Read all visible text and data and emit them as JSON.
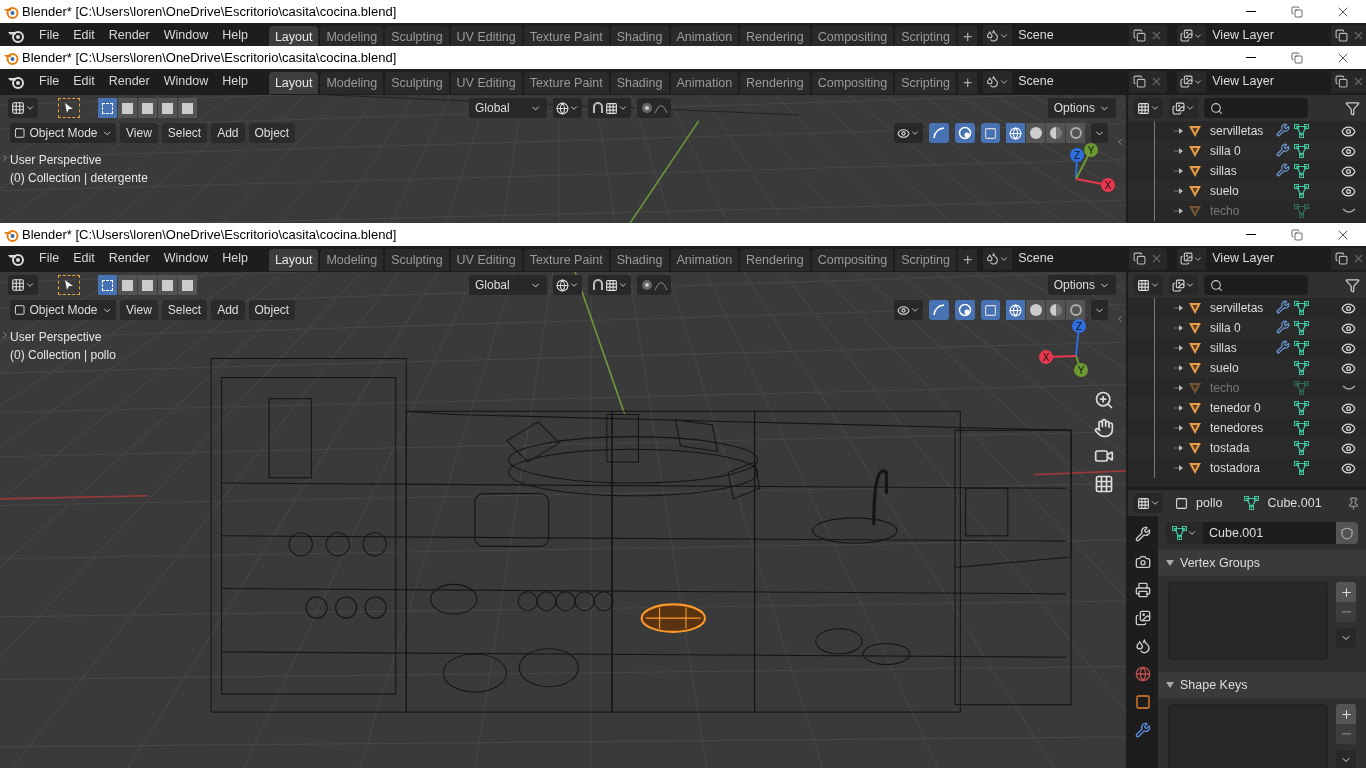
{
  "windows": [
    {
      "title": "Blender* [C:\\Users\\loren\\OneDrive\\Escritorio\\casita\\cocina.blend]",
      "menu": [
        "File",
        "Edit",
        "Render",
        "Window",
        "Help"
      ],
      "workspaces": [
        {
          "label": "Layout",
          "selected": true
        },
        {
          "label": "Modeling",
          "selected": false
        },
        {
          "label": "Sculpting",
          "selected": false
        },
        {
          "label": "UV Editing",
          "selected": false
        },
        {
          "label": "Texture Paint",
          "selected": false
        },
        {
          "label": "Shading",
          "selected": false
        },
        {
          "label": "Animation",
          "selected": false
        },
        {
          "label": "Rendering",
          "selected": false
        },
        {
          "label": "Compositing",
          "selected": false
        },
        {
          "label": "Scripting",
          "selected": false
        }
      ],
      "add_tab": "+",
      "scene": "Scene",
      "view_layer": "View Layer"
    },
    {
      "title": "Blender* [C:\\Users\\loren\\OneDrive\\Escritorio\\casita\\cocina.blend]",
      "menu": [
        "File",
        "Edit",
        "Render",
        "Window",
        "Help"
      ],
      "workspaces": [
        {
          "label": "Layout",
          "selected": true
        },
        {
          "label": "Modeling",
          "selected": false
        },
        {
          "label": "Sculpting",
          "selected": false
        },
        {
          "label": "UV Editing",
          "selected": false
        },
        {
          "label": "Texture Paint",
          "selected": false
        },
        {
          "label": "Shading",
          "selected": false
        },
        {
          "label": "Animation",
          "selected": false
        },
        {
          "label": "Rendering",
          "selected": false
        },
        {
          "label": "Compositing",
          "selected": false
        },
        {
          "label": "Scripting",
          "selected": false
        }
      ],
      "add_tab": "+",
      "scene": "Scene",
      "view_layer": "View Layer",
      "viewport": {
        "transform": "Global",
        "options": "Options",
        "mode": "Object Mode",
        "menus": [
          "View",
          "Select",
          "Add",
          "Object"
        ],
        "perspective": "User Perspective",
        "collection": "(0) Collection | detergente",
        "gizmo": [
          "Z",
          "Y",
          "X"
        ],
        "select_modes": [
          {
            "selected": true
          },
          {
            "selected": false
          },
          {
            "selected": false
          },
          {
            "selected": false
          },
          {
            "selected": false
          }
        ],
        "shading_modes": [
          {
            "kind": "wireframe",
            "selected": true
          },
          {
            "kind": "solid",
            "selected": false
          },
          {
            "kind": "material",
            "selected": false
          },
          {
            "kind": "rendered",
            "selected": false
          }
        ]
      },
      "outliner": [
        {
          "name": "servilletas",
          "modifier": true,
          "hidden": false
        },
        {
          "name": "silla 0",
          "modifier": true,
          "hidden": false
        },
        {
          "name": "sillas",
          "modifier": true,
          "hidden": false
        },
        {
          "name": "suelo",
          "modifier": false,
          "hidden": false
        },
        {
          "name": "techo",
          "modifier": false,
          "hidden": true
        }
      ]
    },
    {
      "title": "Blender* [C:\\Users\\loren\\OneDrive\\Escritorio\\casita\\cocina.blend]",
      "menu": [
        "File",
        "Edit",
        "Render",
        "Window",
        "Help"
      ],
      "workspaces": [
        {
          "label": "Layout",
          "selected": true
        },
        {
          "label": "Modeling",
          "selected": false
        },
        {
          "label": "Sculpting",
          "selected": false
        },
        {
          "label": "UV Editing",
          "selected": false
        },
        {
          "label": "Texture Paint",
          "selected": false
        },
        {
          "label": "Shading",
          "selected": false
        },
        {
          "label": "Animation",
          "selected": false
        },
        {
          "label": "Rendering",
          "selected": false
        },
        {
          "label": "Compositing",
          "selected": false
        },
        {
          "label": "Scripting",
          "selected": false
        }
      ],
      "add_tab": "+",
      "scene": "Scene",
      "view_layer": "View Layer",
      "viewport": {
        "transform": "Global",
        "options": "Options",
        "mode": "Object Mode",
        "menus": [
          "View",
          "Select",
          "Add",
          "Object"
        ],
        "perspective": "User Perspective",
        "collection": "(0) Collection | pollo",
        "gizmo": [
          "Z",
          "Y",
          "X"
        ],
        "select_modes": [
          {
            "selected": true
          },
          {
            "selected": false
          },
          {
            "selected": false
          },
          {
            "selected": false
          },
          {
            "selected": false
          }
        ],
        "shading_modes": [
          {
            "kind": "wireframe",
            "selected": true
          },
          {
            "kind": "solid",
            "selected": false
          },
          {
            "kind": "material",
            "selected": false
          },
          {
            "kind": "rendered",
            "selected": false
          }
        ]
      },
      "outliner": [
        {
          "name": "servilletas",
          "modifier": true,
          "hidden": false
        },
        {
          "name": "silla 0",
          "modifier": true,
          "hidden": false
        },
        {
          "name": "sillas",
          "modifier": true,
          "hidden": false
        },
        {
          "name": "suelo",
          "modifier": false,
          "hidden": false
        },
        {
          "name": "techo",
          "modifier": false,
          "hidden": true
        },
        {
          "name": "tenedor 0",
          "modifier": false,
          "hidden": false
        },
        {
          "name": "tenedores",
          "modifier": false,
          "hidden": false
        },
        {
          "name": "tostada",
          "modifier": false,
          "hidden": false
        },
        {
          "name": "tostadora",
          "modifier": false,
          "hidden": false
        }
      ],
      "properties": {
        "object": "pollo",
        "mesh": "Cube.001",
        "mesh_field": "Cube.001",
        "panels": [
          {
            "title": "Vertex Groups",
            "expanded": true
          },
          {
            "title": "Shape Keys",
            "expanded": true
          }
        ]
      }
    }
  ]
}
